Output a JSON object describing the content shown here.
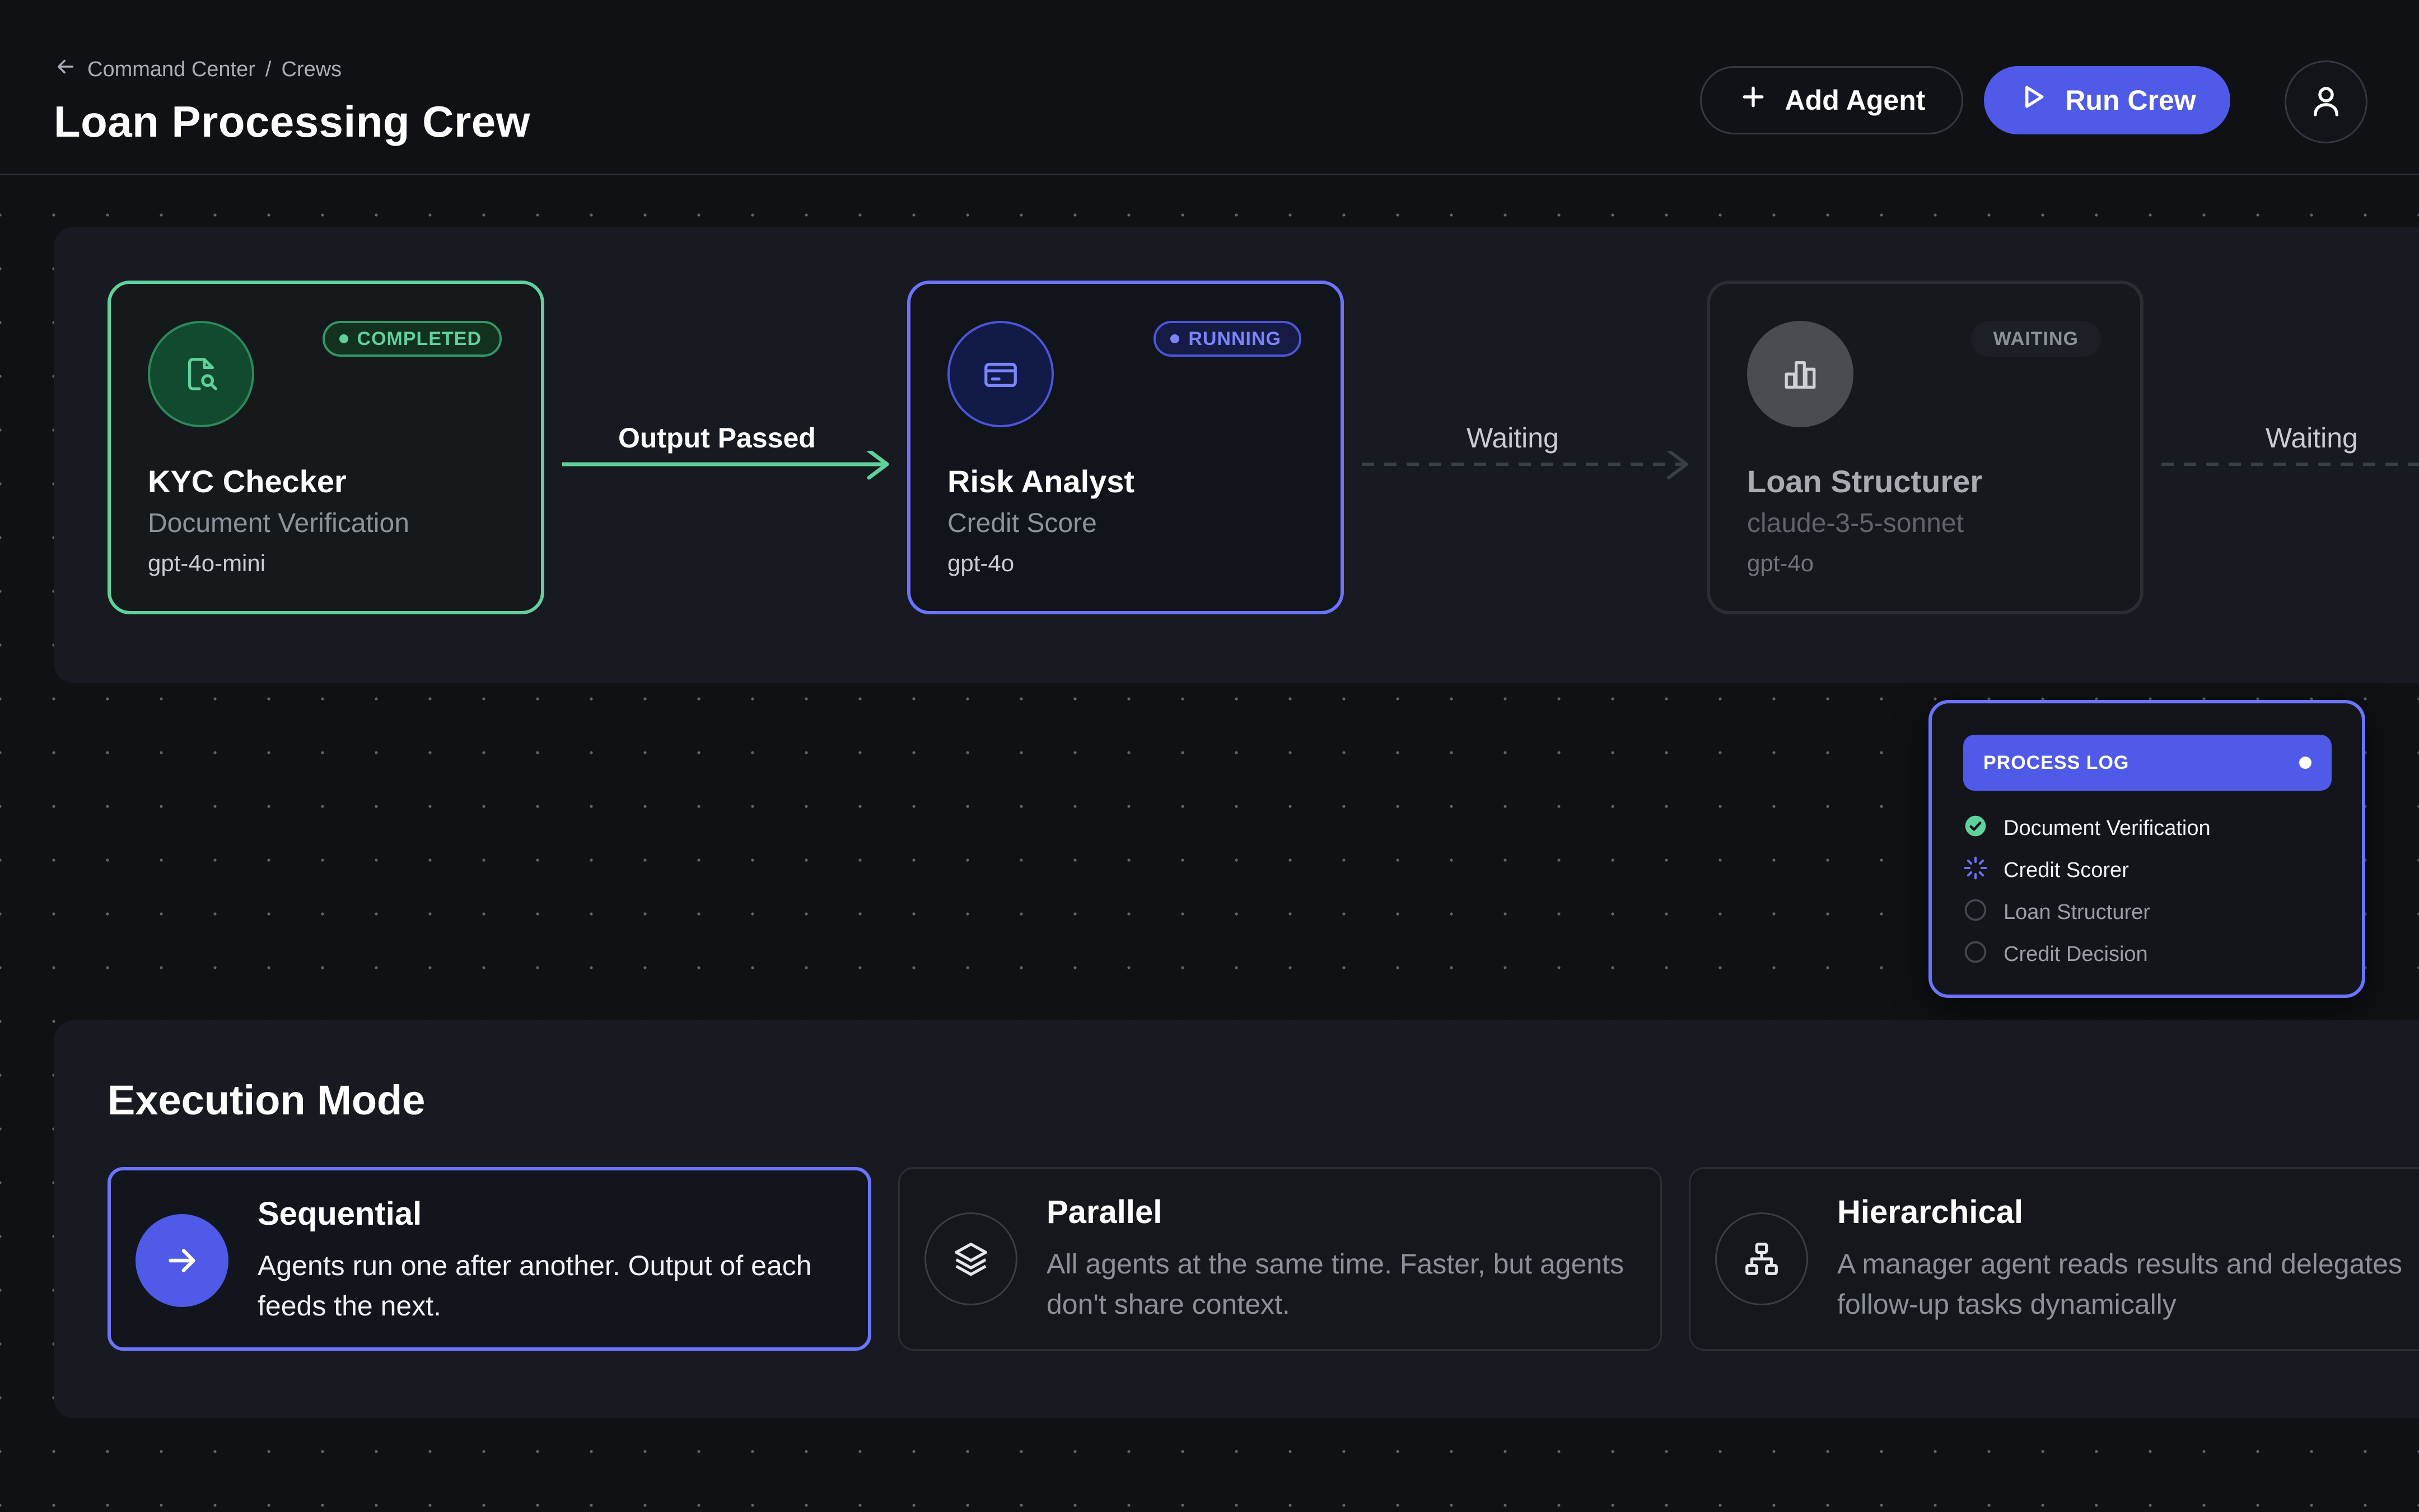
{
  "header": {
    "breadcrumb_parent": "Command Center",
    "breadcrumb_sep": "/",
    "breadcrumb_current": "Crews",
    "title": "Loan Processing Crew",
    "add_agent_label": "Add Agent",
    "run_crew_label": "Run Crew"
  },
  "pipeline": {
    "agents": [
      {
        "name": "KYC Checker",
        "role": "Document Verification",
        "model": "gpt-4o-mini",
        "status": "COMPLETED",
        "icon": "file-search-icon"
      },
      {
        "name": "Risk Analyst",
        "role": "Credit Score",
        "model": "gpt-4o",
        "status": "RUNNING",
        "icon": "credit-card-icon"
      },
      {
        "name": "Loan Structurer",
        "role": "claude-3-5-sonnet",
        "model": "gpt-4o",
        "status": "WAITING",
        "icon": "bar-chart-icon"
      }
    ],
    "connectors": [
      {
        "label": "Output Passed",
        "state": "active"
      },
      {
        "label": "Waiting",
        "state": "pending"
      },
      {
        "label": "Waiting",
        "state": "pending"
      }
    ]
  },
  "process_log": {
    "title": "PROCESS LOG",
    "items": [
      {
        "label": "Document Verification",
        "state": "done"
      },
      {
        "label": "Credit Scorer",
        "state": "in-progress"
      },
      {
        "label": "Loan Structurer",
        "state": "pending"
      },
      {
        "label": "Credit Decision",
        "state": "pending"
      }
    ]
  },
  "execution_mode": {
    "title": "Execution Mode",
    "modes": [
      {
        "title": "Sequential",
        "description": "Agents run one after another. Output of each feeds the next.",
        "selected": true,
        "icon": "arrow-right-icon"
      },
      {
        "title": "Parallel",
        "description": "All agents at the same time. Faster, but agents don't share context.",
        "selected": false,
        "icon": "layers-icon"
      },
      {
        "title": "Hierarchical",
        "description": "A manager agent reads results and delegates follow-up tasks dynamically",
        "selected": false,
        "icon": "hierarchy-icon"
      }
    ]
  },
  "colors": {
    "accent": "#4f5ae8",
    "completed": "#5fd19b",
    "background": "#0f1115",
    "panel": "#171a20"
  }
}
